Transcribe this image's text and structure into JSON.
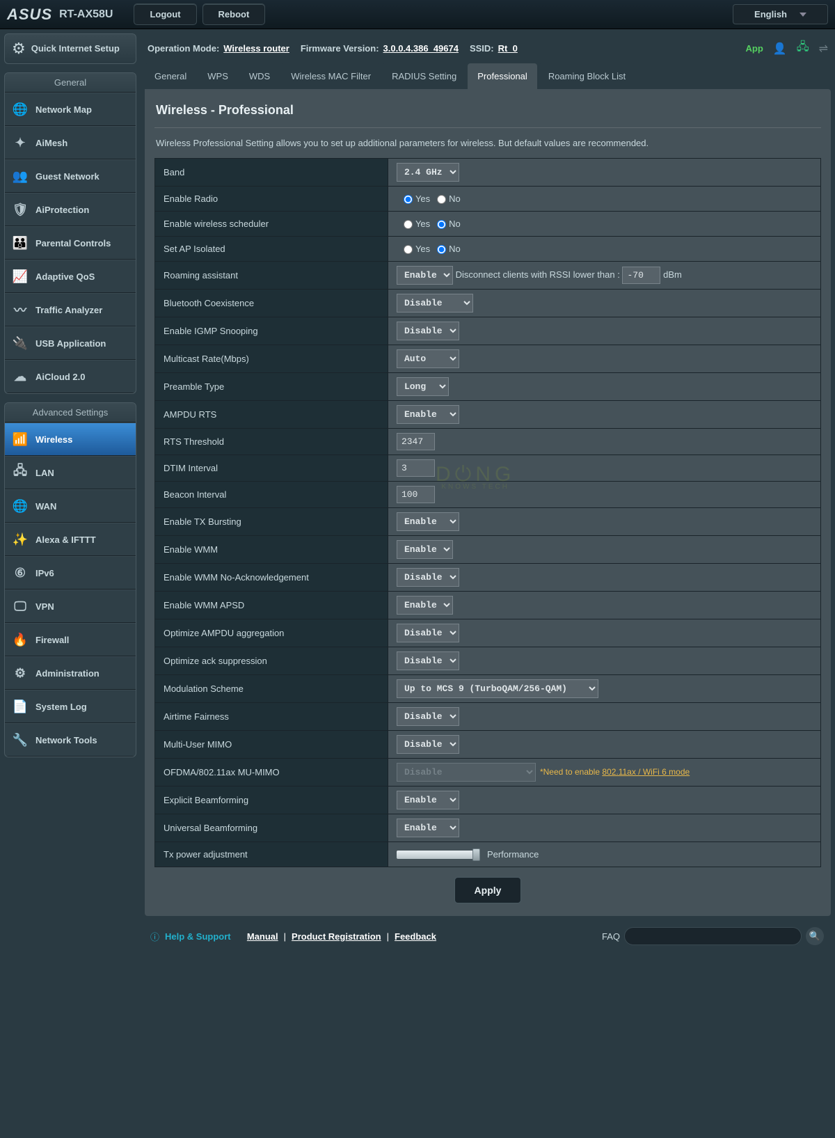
{
  "top": {
    "brand": "ASUS",
    "model": "RT-AX58U",
    "logout": "Logout",
    "reboot": "Reboot",
    "language": "English"
  },
  "status": {
    "opmode_lbl": "Operation Mode:",
    "opmode": "Wireless router",
    "fw_lbl": "Firmware Version:",
    "fw": "3.0.0.4.386_49674",
    "ssid_lbl": "SSID:",
    "ssid": "Rt_0",
    "app": "App"
  },
  "qis": "Quick Internet Setup",
  "sidebar": {
    "general_head": "General",
    "general": [
      {
        "icon": "🌐",
        "label": "Network Map",
        "name": "network-map"
      },
      {
        "icon": "✦",
        "label": "AiMesh",
        "name": "aimesh"
      },
      {
        "icon": "👥",
        "label": "Guest Network",
        "name": "guest-network"
      },
      {
        "icon": "🛡",
        "label": "AiProtection",
        "name": "aiprotection"
      },
      {
        "icon": "👪",
        "label": "Parental Controls",
        "name": "parental-controls"
      },
      {
        "icon": "📈",
        "label": "Adaptive QoS",
        "name": "adaptive-qos"
      },
      {
        "icon": "〰",
        "label": "Traffic Analyzer",
        "name": "traffic-analyzer"
      },
      {
        "icon": "🔌",
        "label": "USB Application",
        "name": "usb-application"
      },
      {
        "icon": "☁",
        "label": "AiCloud 2.0",
        "name": "aicloud"
      }
    ],
    "advanced_head": "Advanced Settings",
    "advanced": [
      {
        "icon": "📶",
        "label": "Wireless",
        "name": "wireless",
        "active": true
      },
      {
        "icon": "🖧",
        "label": "LAN",
        "name": "lan"
      },
      {
        "icon": "🌐",
        "label": "WAN",
        "name": "wan"
      },
      {
        "icon": "✨",
        "label": "Alexa & IFTTT",
        "name": "alexa-ifttt"
      },
      {
        "icon": "⑥",
        "label": "IPv6",
        "name": "ipv6"
      },
      {
        "icon": "🖵",
        "label": "VPN",
        "name": "vpn"
      },
      {
        "icon": "🔥",
        "label": "Firewall",
        "name": "firewall"
      },
      {
        "icon": "⚙",
        "label": "Administration",
        "name": "administration"
      },
      {
        "icon": "📄",
        "label": "System Log",
        "name": "system-log"
      },
      {
        "icon": "🔧",
        "label": "Network Tools",
        "name": "network-tools"
      }
    ]
  },
  "tabs": [
    "General",
    "WPS",
    "WDS",
    "Wireless MAC Filter",
    "RADIUS Setting",
    "Professional",
    "Roaming Block List"
  ],
  "active_tab": 5,
  "page": {
    "title": "Wireless - Professional",
    "desc": "Wireless Professional Setting allows you to set up additional parameters for wireless. But default values are recommended."
  },
  "labels": {
    "yes": "Yes",
    "no": "No"
  },
  "settings": {
    "band": {
      "label": "Band",
      "value": "2.4 GHz"
    },
    "radio": {
      "label": "Enable Radio",
      "value": "yes"
    },
    "sched": {
      "label": "Enable wireless scheduler",
      "value": "no"
    },
    "apiso": {
      "label": "Set AP Isolated",
      "value": "no"
    },
    "roam": {
      "label": "Roaming assistant",
      "value": "Enable",
      "suffix": "Disconnect clients with RSSI lower than :",
      "rssi": "-70",
      "unit": "dBm"
    },
    "btc": {
      "label": "Bluetooth Coexistence",
      "value": "Disable"
    },
    "igmp": {
      "label": "Enable IGMP Snooping",
      "value": "Disable"
    },
    "mcast": {
      "label": "Multicast Rate(Mbps)",
      "value": "Auto"
    },
    "preamble": {
      "label": "Preamble Type",
      "value": "Long"
    },
    "ampdurts": {
      "label": "AMPDU RTS",
      "value": "Enable"
    },
    "rts": {
      "label": "RTS Threshold",
      "value": "2347"
    },
    "dtim": {
      "label": "DTIM Interval",
      "value": "3"
    },
    "beacon": {
      "label": "Beacon Interval",
      "value": "100"
    },
    "txburst": {
      "label": "Enable TX Bursting",
      "value": "Enable"
    },
    "wmm": {
      "label": "Enable WMM",
      "value": "Enable"
    },
    "wmmnoack": {
      "label": "Enable WMM No-Acknowledgement",
      "value": "Disable"
    },
    "wmmapsd": {
      "label": "Enable WMM APSD",
      "value": "Enable"
    },
    "ampduagg": {
      "label": "Optimize AMPDU aggregation",
      "value": "Disable"
    },
    "acksup": {
      "label": "Optimize ack suppression",
      "value": "Disable"
    },
    "mod": {
      "label": "Modulation Scheme",
      "value": "Up to MCS 9 (TurboQAM/256-QAM)"
    },
    "atf": {
      "label": "Airtime Fairness",
      "value": "Disable"
    },
    "mumimo": {
      "label": "Multi-User MIMO",
      "value": "Disable"
    },
    "ofdma": {
      "label": "OFDMA/802.11ax MU-MIMO",
      "value": "Disable",
      "note": "*Need to enable ",
      "link": "802.11ax / WiFi 6 mode"
    },
    "ebf": {
      "label": "Explicit Beamforming",
      "value": "Enable"
    },
    "ubf": {
      "label": "Universal Beamforming",
      "value": "Enable"
    },
    "txpwr": {
      "label": "Tx power adjustment",
      "value": "Performance"
    }
  },
  "apply": "Apply",
  "footer": {
    "help": "Help & Support",
    "manual": "Manual",
    "reg": "Product Registration",
    "fb": "Feedback",
    "faq": "FAQ"
  }
}
